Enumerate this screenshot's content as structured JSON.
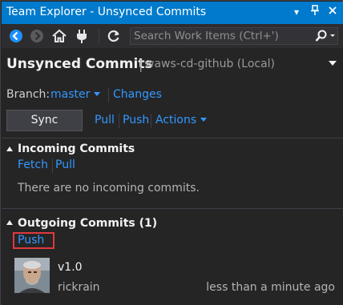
{
  "window": {
    "title": "Team Explorer - Unsynced Commits"
  },
  "toolbar": {
    "search_placeholder": "Search Work Items (Ctrl+')",
    "icons": [
      "back-icon",
      "forward-icon",
      "home-icon",
      "connect-icon",
      "refresh-icon",
      "search-icon"
    ]
  },
  "header": {
    "title": "Unsynced Commits",
    "separator": "|",
    "repo": "waws-cd-github (Local)"
  },
  "branch": {
    "label": "Branch:",
    "value": "master",
    "changes_link": "Changes"
  },
  "sync": {
    "sync_label": "Sync",
    "pull_label": "Pull",
    "push_label": "Push",
    "actions_label": "Actions"
  },
  "incoming": {
    "title": "Incoming Commits",
    "fetch_label": "Fetch",
    "pull_label": "Pull",
    "empty_message": "There are no incoming commits."
  },
  "outgoing": {
    "title": "Outgoing Commits (1)",
    "push_label": "Push",
    "commits": [
      {
        "message": "v1.0",
        "author": "rickrain",
        "time": "less than a minute ago"
      }
    ]
  },
  "colors": {
    "titlebar": "#007acc",
    "background": "#252526",
    "link": "#3399ff",
    "highlight_box": "#e0393e"
  }
}
